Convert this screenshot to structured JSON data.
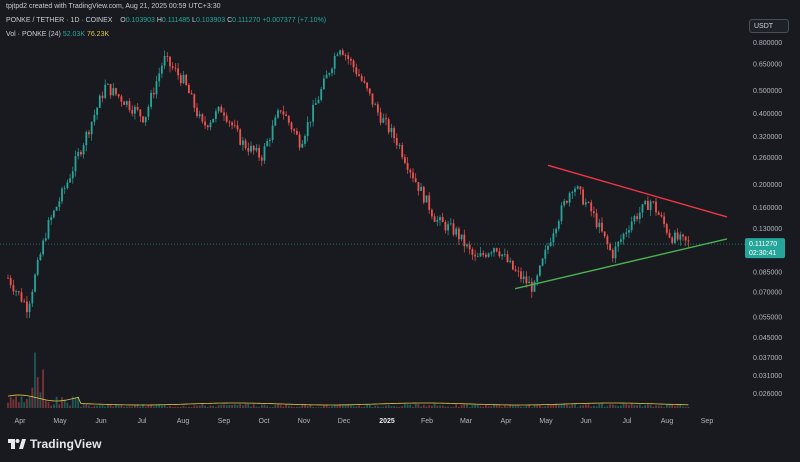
{
  "header": {
    "created_line": "tpjtpd2 created with TradingView.com, Aug 21, 2025 00:59 UTC+3:30",
    "symbol": "PONKE / TETHER · 1D · COINEX",
    "open_label": "O",
    "open": "0.103903",
    "high_label": "H",
    "high": "0.111485",
    "low_label": "L",
    "low": "0.103903",
    "close_label": "C",
    "close": "0.111270",
    "change": "+0.007377 (+7.10%)",
    "vol_label": "Vol · PONKE (24)",
    "vol_value_1": "52.03K",
    "vol_value_2": "76.23K"
  },
  "price_axis": {
    "unit": "USDT",
    "ticks": [
      "0.800000",
      "0.650000",
      "0.500000",
      "0.400000",
      "0.320000",
      "0.260000",
      "0.200000",
      "0.160000",
      "0.130000",
      "0.085000",
      "0.070000",
      "0.055000",
      "0.045000",
      "0.037000",
      "0.031000",
      "0.026000"
    ]
  },
  "last_price": {
    "value": "0.111270",
    "countdown": "02:30:41"
  },
  "branding": {
    "name": "TradingView"
  },
  "colors": {
    "up": "#26a69a",
    "down": "#ef5350",
    "upper_trendline": "#f23645",
    "lower_trendline": "#4caf50",
    "volume_ma": "#e2c744",
    "background": "#181a20"
  },
  "chart_data": {
    "type": "candlestick",
    "scale": "log",
    "x_axis_labels": [
      "Apr",
      "May",
      "Jun",
      "Jul",
      "Aug",
      "Sep",
      "Oct",
      "Nov",
      "Dec",
      "2025",
      "Feb",
      "Mar",
      "Apr",
      "May",
      "Jun",
      "Jul",
      "Aug",
      "Sep"
    ],
    "ylim": [
      0.024,
      0.85
    ],
    "closing_path": [
      {
        "t": "Apr",
        "v": 0.08
      },
      {
        "t": "Apr",
        "v": 0.06
      },
      {
        "t": "Apr",
        "v": 0.13
      },
      {
        "t": "May",
        "v": 0.2
      },
      {
        "t": "May",
        "v": 0.32
      },
      {
        "t": "May",
        "v": 0.52
      },
      {
        "t": "Jun",
        "v": 0.45
      },
      {
        "t": "Jun",
        "v": 0.38
      },
      {
        "t": "Jul",
        "v": 0.68
      },
      {
        "t": "Jul",
        "v": 0.55
      },
      {
        "t": "Jul",
        "v": 0.35
      },
      {
        "t": "Aug",
        "v": 0.42
      },
      {
        "t": "Aug",
        "v": 0.3
      },
      {
        "t": "Sep",
        "v": 0.26
      },
      {
        "t": "Oct",
        "v": 0.42
      },
      {
        "t": "Oct",
        "v": 0.3
      },
      {
        "t": "Nov",
        "v": 0.48
      },
      {
        "t": "Nov",
        "v": 0.78
      },
      {
        "t": "Dec",
        "v": 0.58
      },
      {
        "t": "Dec",
        "v": 0.4
      },
      {
        "t": "2025",
        "v": 0.3
      },
      {
        "t": "2025",
        "v": 0.2
      },
      {
        "t": "Feb",
        "v": 0.14
      },
      {
        "t": "Feb",
        "v": 0.125
      },
      {
        "t": "Mar",
        "v": 0.095
      },
      {
        "t": "Mar",
        "v": 0.11
      },
      {
        "t": "Apr",
        "v": 0.085
      },
      {
        "t": "Apr",
        "v": 0.072
      },
      {
        "t": "May",
        "v": 0.13
      },
      {
        "t": "May",
        "v": 0.2
      },
      {
        "t": "Jun",
        "v": 0.15
      },
      {
        "t": "Jun",
        "v": 0.1
      },
      {
        "t": "Jul",
        "v": 0.14
      },
      {
        "t": "Jul",
        "v": 0.17
      },
      {
        "t": "Aug",
        "v": 0.12
      },
      {
        "t": "Aug",
        "v": 0.111
      }
    ],
    "trendlines": [
      {
        "name": "upper",
        "from": {
          "t": "May",
          "v": 0.24
        },
        "to": {
          "t": "Sep",
          "v": 0.145
        }
      },
      {
        "name": "lower",
        "from": {
          "t": "Apr",
          "v": 0.072
        },
        "to": {
          "t": "Sep",
          "v": 0.117
        }
      }
    ],
    "volume": {
      "ma_label": "Vol · PONKE (24)",
      "ma_values": [
        "52.03K",
        "76.23K"
      ]
    }
  }
}
